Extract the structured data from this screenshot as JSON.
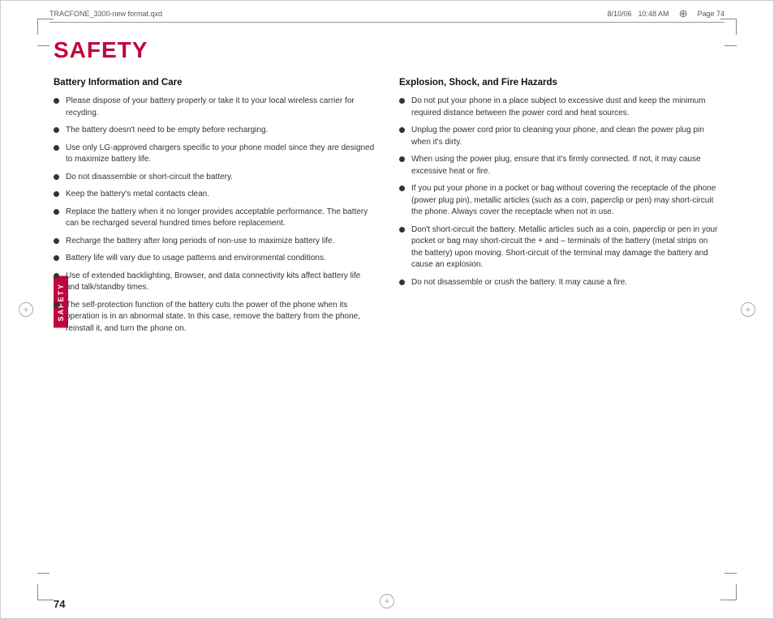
{
  "header": {
    "filename": "TRACFONE_3300-new format.qxd",
    "date": "8/10/06",
    "time": "10:48 AM",
    "page": "Page 74"
  },
  "title": "SAFETY",
  "sidebar_label": "SAFETY",
  "page_number": "74",
  "left_column": {
    "heading": "Battery Information and Care",
    "bullets": [
      "Please dispose of your battery properly or take it to your local wireless carrier for recyding.",
      "The battery doesn't need to be empty before recharging.",
      "Use only LG-approved chargers specific to your phone model since they are designed to maximize battery life.",
      "Do not disassemble or short-circuit the battery.",
      "Keep the battery's metal contacts clean.",
      "Replace the battery when it no longer provides acceptable performance. The battery can be recharged several hundred times before replacement.",
      "Recharge the battery after long periods of non-use to maximize battery life.",
      "Battery life will vary due to usage patterns and environmental conditions.",
      "Use of extended backlighting, Browser, and data connectivity kits affect battery life and talk/standby times.",
      "The self-protection function of the battery cuts the power of the phone when its operation is in an abnormal state. In this case, remove the battery from the phone, reinstall it, and turn the phone on."
    ]
  },
  "right_column": {
    "heading": "Explosion, Shock, and Fire Hazards",
    "bullets": [
      "Do not put your phone in a place subject to excessive dust and keep the minimum required distance between the power cord and heat sources.",
      "Unplug the power cord prior to cleaning your phone, and clean the power plug pin when it's dirty.",
      "When using the power plug, ensure that it's firmly connected. If not, it may cause excessive heat or fire.",
      "If you put your phone in a pocket or bag without covering the receptacle of the phone (power plug pin), metallic articles (such as a coin, paperclip or pen) may short-circuit the phone. Always cover the receptacle when not in use.",
      "Don't short-circuit the battery. Metallic articles such as a coin, paperclip or pen in your pocket or bag may short-circuit the + and – terminals of the battery (metal strips on the battery) upon moving. Short-circuit of the terminal may damage the battery and cause an explosion.",
      "Do not disassemble or crush the battery. It may cause a fire."
    ]
  }
}
